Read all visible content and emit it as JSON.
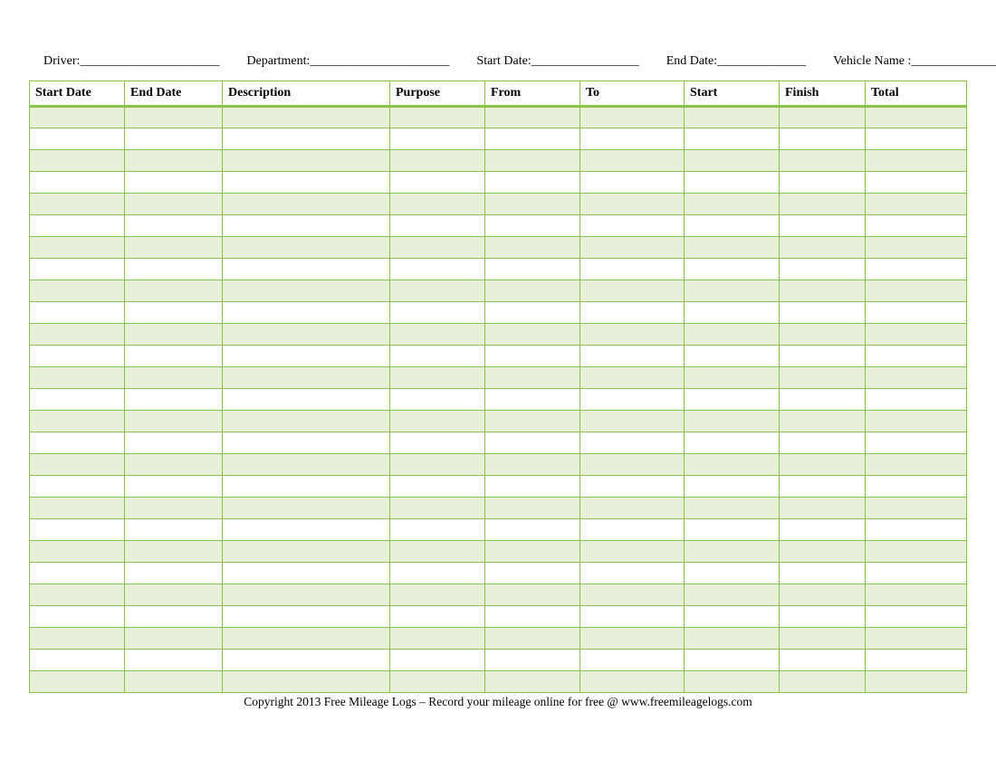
{
  "header": {
    "driver_label": "Driver:",
    "driver_blank": "______________________",
    "department_label": "Department:",
    "department_blank": "______________________",
    "start_date_label": "Start Date:",
    "start_date_blank": "_________________",
    "end_date_label": "End Date:",
    "end_date_blank": "______________",
    "vehicle_label": "Vehicle Name :",
    "vehicle_blank": "________________"
  },
  "columns": {
    "start_date": "Start Date",
    "end_date": "End Date",
    "description": "Description",
    "purpose": "Purpose",
    "from": "From",
    "to": "To",
    "start": "Start",
    "finish": "Finish",
    "total": "Total"
  },
  "row_count": 27,
  "footer": "Copyright 2013 Free Mileage Logs – Record your mileage online for free @ www.freemileagelogs.com"
}
